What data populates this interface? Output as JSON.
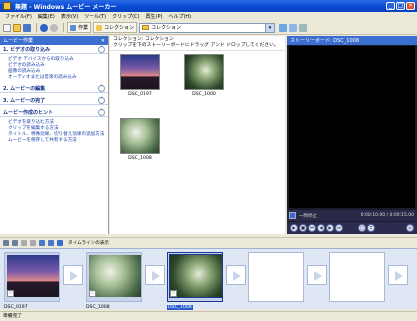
{
  "window": {
    "title": "無題 - Windows ムービー メーカー"
  },
  "menu": [
    "ファイル(F)",
    "編集(E)",
    "表示(V)",
    "ツール(T)",
    "クリップ(C)",
    "再生(P)",
    "ヘルプ(H)"
  ],
  "toolbar": {
    "tasks_label": "作業",
    "collections_label": "コレクション",
    "combo_value": "コレクション"
  },
  "taskpane": {
    "header": "ムービー作業",
    "sections": [
      {
        "title": "1. ビデオの取り込み",
        "links": [
          "ビデオ デバイスからの取り込み",
          "ビデオの読み込み",
          "画像の読み込み",
          "オーディオまたは音楽の読み込み"
        ]
      },
      {
        "title": "2. ムービーの編集",
        "links": []
      },
      {
        "title": "3. ムービーの完了",
        "links": []
      },
      {
        "title": "ムービー作成のヒント",
        "links": [
          "ビデオを取り込む方法",
          "クリップを編集する方法",
          "タイトル、特殊効果、切り替え効果の追加方法",
          "ムービーを保存して共有する方法"
        ]
      }
    ]
  },
  "collection": {
    "heading": "コレクション: コレクション",
    "hint": "クリップを下のストーリーボードにドラッグ アンド ドロップしてください。",
    "items": [
      {
        "label": "DSC_0197",
        "thumb": "sunset"
      },
      {
        "label": "DSC_1000",
        "thumb": "ladybug"
      },
      {
        "label": "DSC_1008",
        "thumb": "green"
      }
    ]
  },
  "monitor": {
    "title": "ストーリーボード: DSC_1008",
    "status": "一時停止",
    "time": "0:00:10.00 / 0:00:15.00"
  },
  "storyboard": {
    "toolbar_label": "タイムラインの表示",
    "clips": [
      {
        "label": "DSC_0197",
        "thumb": "sunset"
      },
      {
        "label": "DSC_1008",
        "thumb": "green"
      },
      {
        "label": "DSC_1008",
        "thumb": "ladybug",
        "selected": true
      }
    ]
  },
  "status": {
    "text": "準備完了"
  }
}
